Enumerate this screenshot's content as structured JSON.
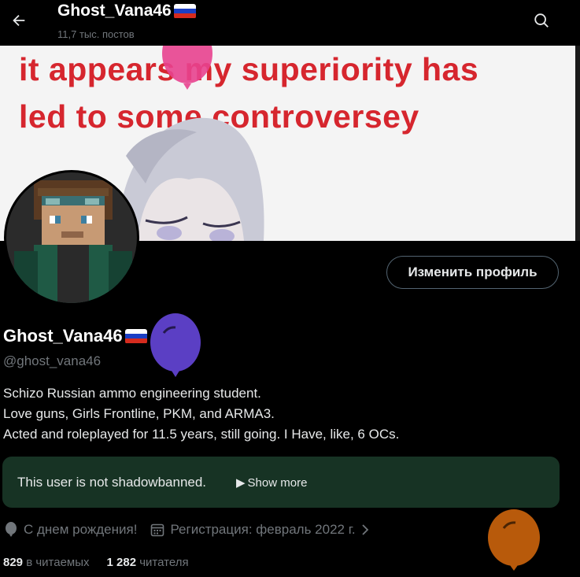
{
  "header": {
    "name": "Ghost_Vana46",
    "posts": "11,7 тыс. постов"
  },
  "banner": {
    "line1": "it appears my superiority has",
    "line2": "led to some controversey"
  },
  "profile": {
    "edit_label": "Изменить профиль",
    "display_name": "Ghost_Vana46",
    "handle": "@ghost_vana46",
    "bio": [
      "Schizo Russian ammo engineering student.",
      "Love guns, Girls Frontline, PKM, and ARMA3.",
      "Acted and roleplayed for 11.5 years, still going. I Have, like, 6 OCs."
    ]
  },
  "shadowban": {
    "text": "This user is not shadowbanned.",
    "show_more": "Show more"
  },
  "meta": {
    "birthday": "С днем рождения!",
    "joined": "Регистрация: февраль 2022 г."
  },
  "stats": {
    "following_count": "829",
    "following_label": "в читаемых",
    "followers_count": "1 282",
    "followers_label": "читателя"
  },
  "colors": {
    "accent_pink": "#e8428f",
    "balloon_purple": "#5b3fc4",
    "balloon_orange": "#b85a0b",
    "banner_red": "#d6262e",
    "shadowban_bg": "#173324"
  }
}
